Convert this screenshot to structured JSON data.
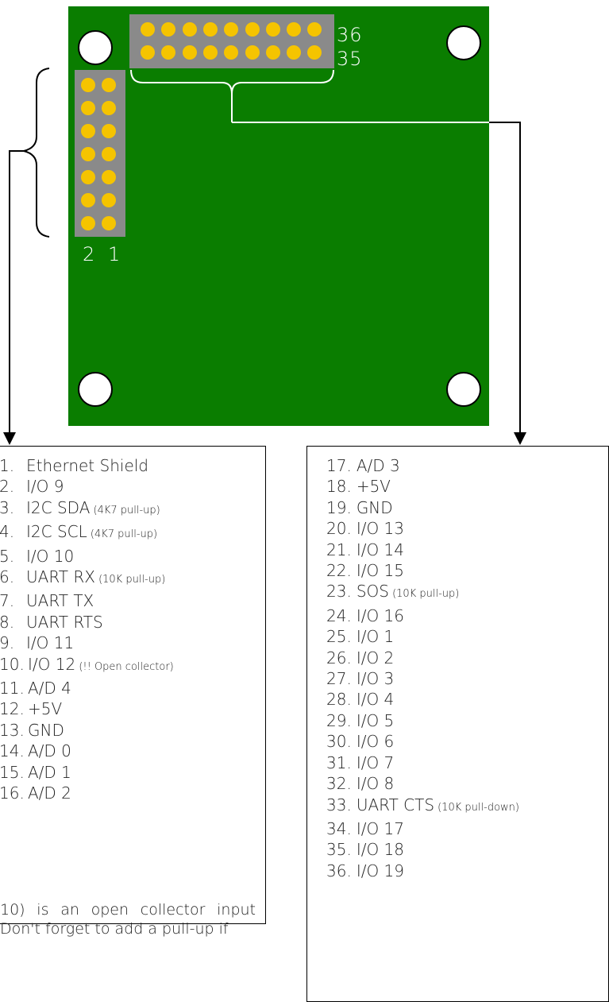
{
  "board": {
    "header_right_label_top": "36",
    "header_right_label_bottom": "35",
    "header_left_label_col2": "2",
    "header_left_label_col1": "1"
  },
  "left_pins": [
    {
      "num": "1.",
      "name": "Ethernet Shield",
      "note": ""
    },
    {
      "num": "2.",
      "name": "I/O 9",
      "note": ""
    },
    {
      "num": "3.",
      "name": "I2C SDA",
      "note": "(4K7 pull-up)"
    },
    {
      "num": "4.",
      "name": "I2C SCL",
      "note": "(4K7 pull-up)"
    },
    {
      "num": "5.",
      "name": "I/O 10",
      "note": ""
    },
    {
      "num": "6.",
      "name": "UART RX",
      "note": "(10K pull-up)"
    },
    {
      "num": "7.",
      "name": "UART TX",
      "note": ""
    },
    {
      "num": "8.",
      "name": "UART RTS",
      "note": ""
    },
    {
      "num": "9.",
      "name": "I/O 11",
      "note": ""
    },
    {
      "num": "10.",
      "name": "I/O 12",
      "note": "(!! Open collector)"
    },
    {
      "num": "11.",
      "name": "A/D 4",
      "note": ""
    },
    {
      "num": "12.",
      "name": "+5V",
      "note": ""
    },
    {
      "num": "13.",
      "name": "GND",
      "note": ""
    },
    {
      "num": "14.",
      "name": "A/D 0",
      "note": ""
    },
    {
      "num": "15.",
      "name": "A/D 1",
      "note": ""
    },
    {
      "num": "16.",
      "name": "A/D 2",
      "note": ""
    }
  ],
  "right_pins": [
    {
      "num": "17.",
      "name": "A/D 3",
      "note": ""
    },
    {
      "num": "18.",
      "name": "+5V",
      "note": ""
    },
    {
      "num": "19.",
      "name": "GND",
      "note": ""
    },
    {
      "num": "20.",
      "name": "I/O 13",
      "note": ""
    },
    {
      "num": "21.",
      "name": "I/O 14",
      "note": ""
    },
    {
      "num": "22.",
      "name": "I/O 15",
      "note": ""
    },
    {
      "num": "23.",
      "name": "SOS",
      "note": "(10K pull-up)"
    },
    {
      "num": "24.",
      "name": "I/O 16",
      "note": ""
    },
    {
      "num": "25.",
      "name": "I/O 1",
      "note": ""
    },
    {
      "num": "26.",
      "name": "I/O 2",
      "note": ""
    },
    {
      "num": "27.",
      "name": "I/O 3",
      "note": ""
    },
    {
      "num": "28.",
      "name": "I/O 4",
      "note": ""
    },
    {
      "num": "29.",
      "name": "I/O 5",
      "note": ""
    },
    {
      "num": "30.",
      "name": "I/O 6",
      "note": ""
    },
    {
      "num": "31.",
      "name": "I/O 7",
      "note": ""
    },
    {
      "num": "32.",
      "name": "I/O 8",
      "note": ""
    },
    {
      "num": "33.",
      "name": "UART CTS",
      "note": "(10K pull-down)"
    },
    {
      "num": "34.",
      "name": "I/O 17",
      "note": ""
    },
    {
      "num": "35.",
      "name": "I/O 18",
      "note": ""
    },
    {
      "num": "36.",
      "name": "I/O 19",
      "note": ""
    }
  ],
  "footnote": "10) is an open collector input Don't forget to add a pull-up if"
}
